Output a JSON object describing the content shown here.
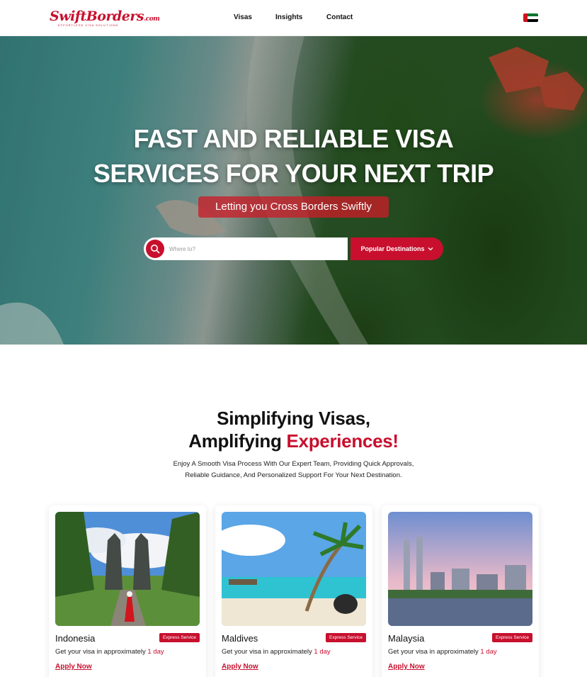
{
  "nav": {
    "logo_text": "SwiftBorders",
    "logo_suffix": ".com",
    "logo_tagline": "EFFORTLESS VISA SOLUTIONS",
    "links": [
      "Visas",
      "Insights",
      "Contact"
    ],
    "flag_icon": "uae-flag-icon"
  },
  "hero": {
    "title_line1": "FAST AND RELIABLE VISA",
    "title_line2": "SERVICES FOR YOUR NEXT TRIP",
    "subtitle": "Letting you Cross Borders Swiftly",
    "search_placeholder": "Where to?",
    "dest_button": "Popular Destinations"
  },
  "section": {
    "title_line1": "Simplifying Visas,",
    "title_line2_a": "Amplifying ",
    "title_line2_b": "Experiences!",
    "desc_line1": "Enjoy A Smooth Visa Process With Our Expert Team, Providing Quick Approvals,",
    "desc_line2": "Reliable Guidance, And Personalized Support For Your Next Destination."
  },
  "cards": [
    {
      "name": "Indonesia",
      "badge": "Express Service",
      "text": "Get your visa in approximately ",
      "days": "1 day",
      "link": "Apply Now"
    },
    {
      "name": "Maldives",
      "badge": "Express Service",
      "text": "Get your visa in approximately ",
      "days": "1 day",
      "link": "Apply Now"
    },
    {
      "name": "Malaysia",
      "badge": "Express Service",
      "text": "Get your visa in approximately ",
      "days": "1 day",
      "link": "Apply Now"
    }
  ],
  "colors": {
    "brand": "#c8102e",
    "text": "#111111"
  }
}
